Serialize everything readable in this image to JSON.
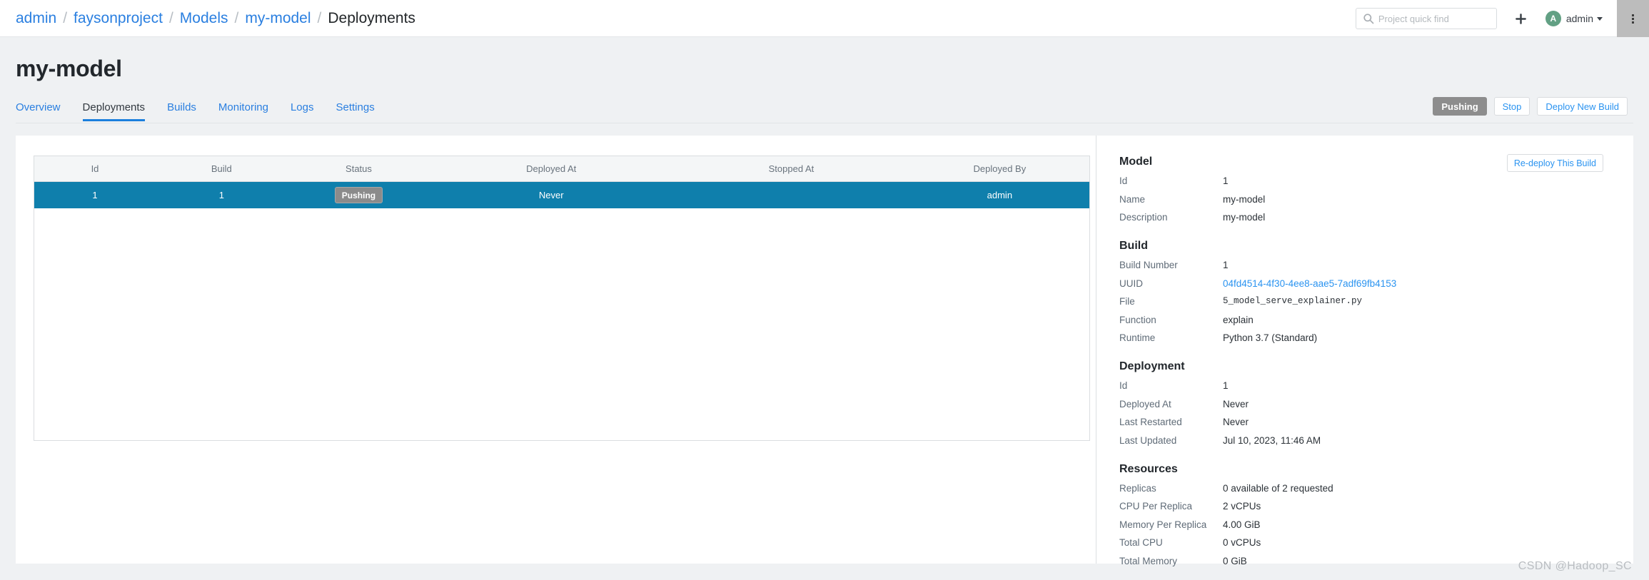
{
  "topbar": {
    "breadcrumb": [
      {
        "label": "admin",
        "current": false
      },
      {
        "label": "faysonproject",
        "current": false
      },
      {
        "label": "Models",
        "current": false
      },
      {
        "label": "my-model",
        "current": false
      },
      {
        "label": "Deployments",
        "current": true
      }
    ],
    "separator": "/",
    "search": {
      "placeholder": "Project quick find",
      "value": "",
      "icon": "search-icon"
    },
    "add_icon": "plus-icon",
    "user": {
      "avatar_initial": "A",
      "name": "admin",
      "avatar_color": "#62a084"
    },
    "overflow_icon": "kebab-menu-icon"
  },
  "page": {
    "title": "my-model",
    "actions": {
      "status_label": "Pushing",
      "stop_label": "Stop",
      "deploy_label": "Deploy New Build"
    },
    "tabs": [
      {
        "label": "Overview",
        "active": false
      },
      {
        "label": "Deployments",
        "active": true
      },
      {
        "label": "Builds",
        "active": false
      },
      {
        "label": "Monitoring",
        "active": false
      },
      {
        "label": "Logs",
        "active": false
      },
      {
        "label": "Settings",
        "active": false
      }
    ]
  },
  "table": {
    "columns": [
      "Id",
      "Build",
      "Status",
      "Deployed At",
      "Stopped At",
      "Deployed By"
    ],
    "rows": [
      {
        "id": "1",
        "build": "1",
        "status": "Pushing",
        "deployed_at": "Never",
        "stopped_at": "",
        "deployed_by": "admin",
        "selected": true
      }
    ]
  },
  "detail": {
    "redeploy_label": "Re-deploy This Build",
    "sections": [
      {
        "title": "Model",
        "rows": [
          {
            "key": "Id",
            "value": "1"
          },
          {
            "key": "Name",
            "value": "my-model"
          },
          {
            "key": "Description",
            "value": "my-model"
          }
        ]
      },
      {
        "title": "Build",
        "rows": [
          {
            "key": "Build Number",
            "value": "1"
          },
          {
            "key": "UUID",
            "value": "04fd4514-4f30-4ee8-aae5-7adf69fb4153"
          },
          {
            "key": "File",
            "value": "5_model_serve_explainer.py"
          },
          {
            "key": "Function",
            "value": "explain"
          },
          {
            "key": "Runtime",
            "value": "Python 3.7 (Standard)"
          }
        ]
      },
      {
        "title": "Deployment",
        "rows": [
          {
            "key": "Id",
            "value": "1"
          },
          {
            "key": "Deployed At",
            "value": "Never"
          },
          {
            "key": "Last Restarted",
            "value": "Never"
          },
          {
            "key": "Last Updated",
            "value": "Jul 10, 2023, 11:46 AM"
          }
        ]
      },
      {
        "title": "Resources",
        "rows": [
          {
            "key": "Replicas",
            "value": "0 available of 2 requested"
          },
          {
            "key": "CPU Per Replica",
            "value": "2 vCPUs"
          },
          {
            "key": "Memory Per Replica",
            "value": "4.00 GiB"
          },
          {
            "key": "Total CPU",
            "value": "0 vCPUs"
          },
          {
            "key": "Total Memory",
            "value": "0 GiB"
          }
        ]
      }
    ]
  },
  "watermark": "CSDN @Hadoop_SC",
  "colors": {
    "link": "#2a7fe0",
    "accent": "#1b7fdd",
    "row_selected": "#0f7fac",
    "status_badge": "#8b8b8b",
    "page_bg": "#eff1f3"
  }
}
